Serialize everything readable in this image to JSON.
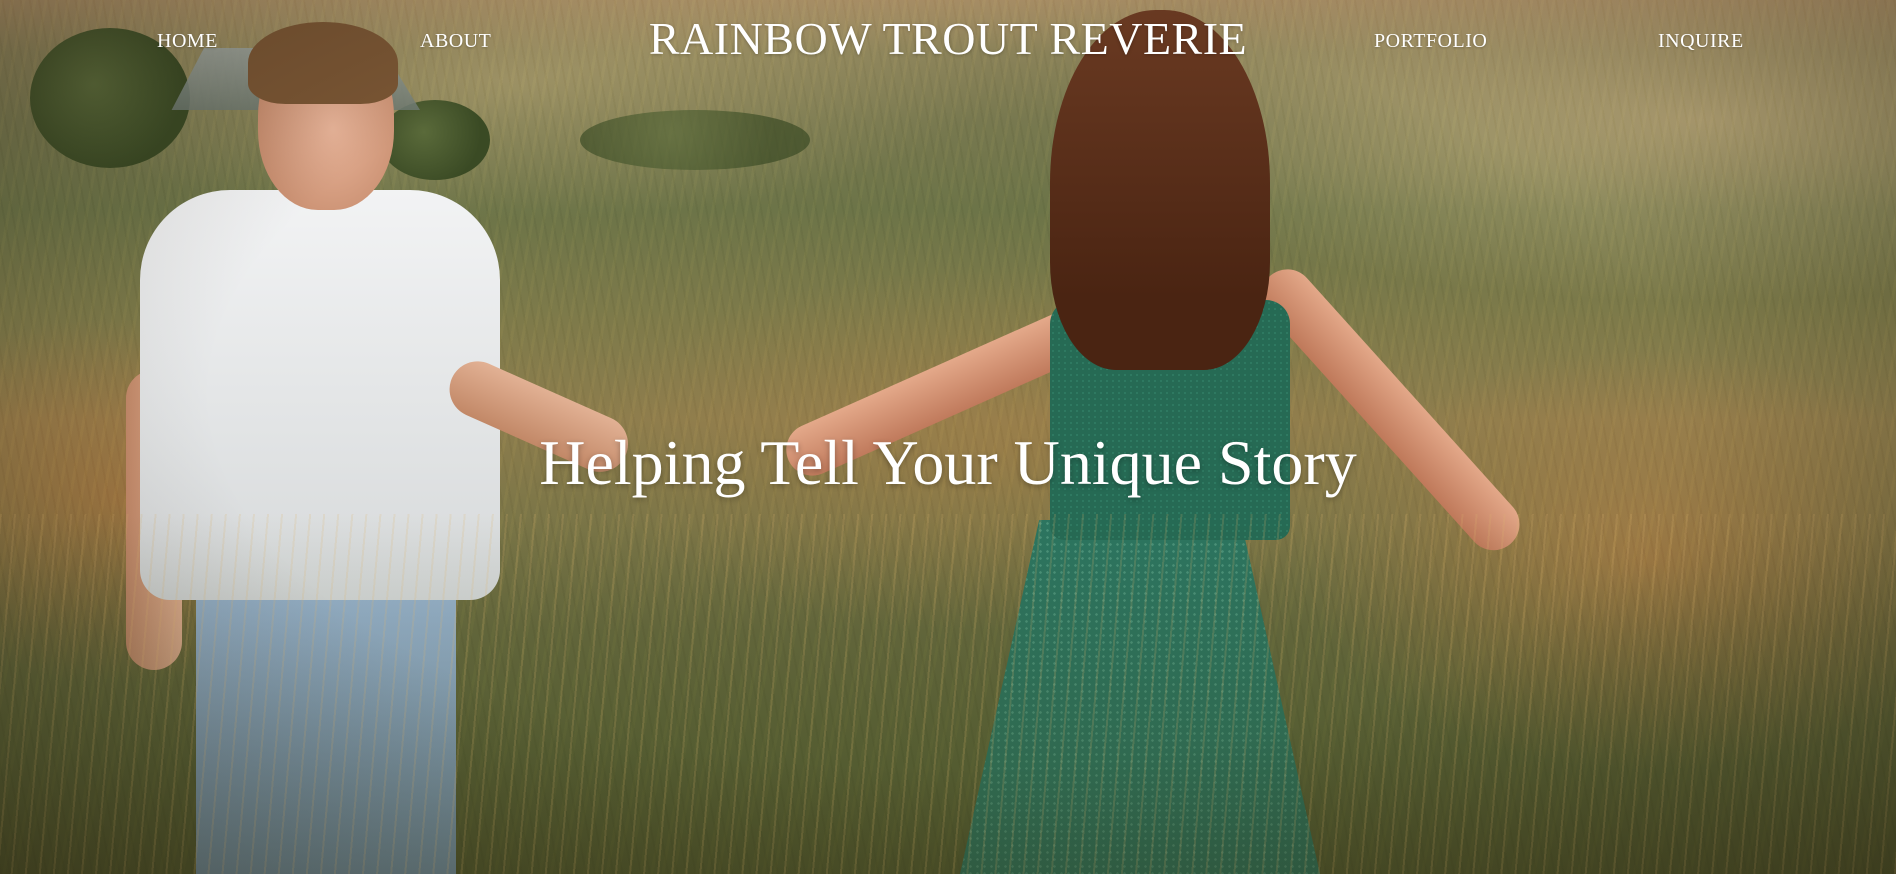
{
  "site": {
    "brand": "RAINBOW TROUT REVERIE"
  },
  "nav": {
    "items": [
      {
        "label": "HOME"
      },
      {
        "label": "ABOUT"
      },
      {
        "label": "PORTFOLIO"
      },
      {
        "label": "INQUIRE"
      }
    ]
  },
  "hero": {
    "headline": "Helping Tell Your Unique Story",
    "image_subject": "couple-in-meadow-photo"
  },
  "colors": {
    "text": "#ffffff",
    "dress": "#2c7560",
    "meadow": "#7a7547"
  }
}
